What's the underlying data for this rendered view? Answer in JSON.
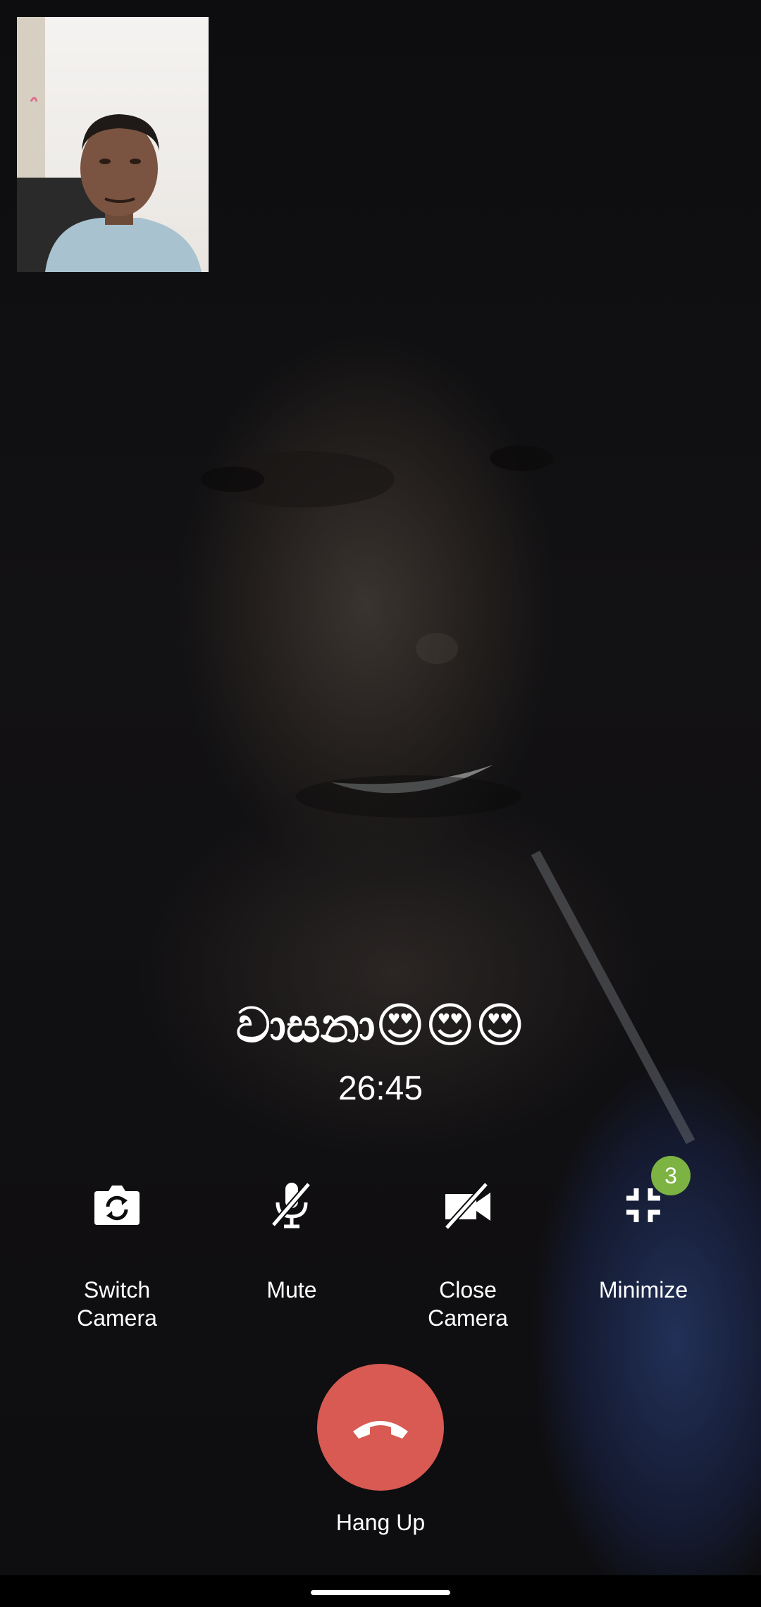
{
  "call": {
    "caller_name": "වාසනා😍😍😍",
    "duration": "26:45"
  },
  "controls": {
    "switch_camera": {
      "label": "Switch\nCamera",
      "icon": "switch-camera-icon"
    },
    "mute": {
      "label": "Mute",
      "icon": "mic-off-icon"
    },
    "close_camera": {
      "label": "Close\nCamera",
      "icon": "camera-off-icon"
    },
    "minimize": {
      "label": "Minimize",
      "icon": "minimize-icon",
      "badge_count": "3"
    }
  },
  "hang_up": {
    "label": "Hang Up",
    "icon": "phone-hangup-icon"
  },
  "colors": {
    "hang_up": "#d85a53",
    "badge": "#7cb342",
    "text": "#ffffff",
    "background": "#0b0b0d"
  }
}
